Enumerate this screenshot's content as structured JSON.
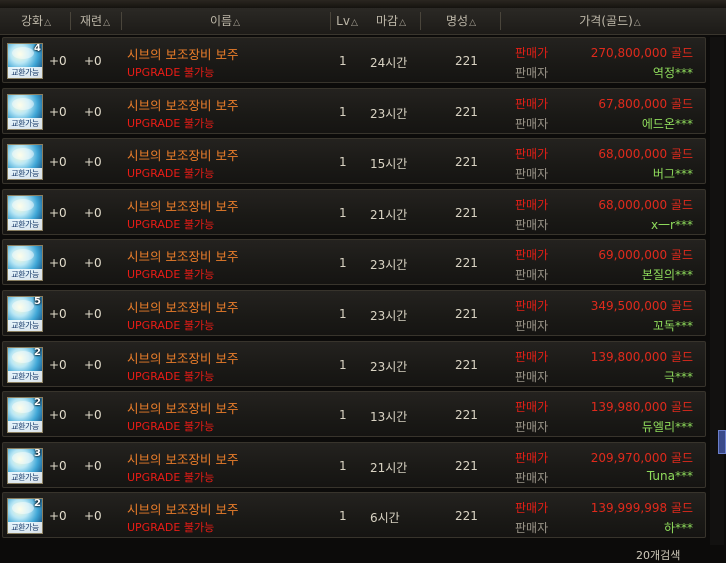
{
  "header": {
    "enhance": "강화",
    "refine": "재련",
    "name": "이름",
    "lv": "Lv",
    "deadline": "마감",
    "fame": "명성",
    "price": "가격(골드)",
    "sort_icon": "triangle-sort-icon"
  },
  "rows": [
    {
      "stack": "4",
      "icon_label": "교환가능",
      "enhance": "+0",
      "refine": "+0",
      "name": "시브의 보조장비 보주",
      "upgrade": "UPGRADE 불가능",
      "lv": "1",
      "deadline": "24시간",
      "fame": "221",
      "seller_type": "판매가",
      "seller_label": "판매자",
      "price": "270,800,000 골드",
      "seller": "역정***"
    },
    {
      "stack": "",
      "icon_label": "교환가능",
      "enhance": "+0",
      "refine": "+0",
      "name": "시브의 보조장비 보주",
      "upgrade": "UPGRADE 불가능",
      "lv": "1",
      "deadline": "23시간",
      "fame": "221",
      "seller_type": "판매가",
      "seller_label": "판매자",
      "price": "67,800,000 골드",
      "seller": "에드온***"
    },
    {
      "stack": "",
      "icon_label": "교환가능",
      "enhance": "+0",
      "refine": "+0",
      "name": "시브의 보조장비 보주",
      "upgrade": "UPGRADE 불가능",
      "lv": "1",
      "deadline": "15시간",
      "fame": "221",
      "seller_type": "판매가",
      "seller_label": "판매자",
      "price": "68,000,000 골드",
      "seller": "버그***"
    },
    {
      "stack": "",
      "icon_label": "교환가능",
      "enhance": "+0",
      "refine": "+0",
      "name": "시브의 보조장비 보주",
      "upgrade": "UPGRADE 불가능",
      "lv": "1",
      "deadline": "21시간",
      "fame": "221",
      "seller_type": "판매가",
      "seller_label": "판매자",
      "price": "68,000,000 골드",
      "seller": "x一r***"
    },
    {
      "stack": "",
      "icon_label": "교환가능",
      "enhance": "+0",
      "refine": "+0",
      "name": "시브의 보조장비 보주",
      "upgrade": "UPGRADE 불가능",
      "lv": "1",
      "deadline": "23시간",
      "fame": "221",
      "seller_type": "판매가",
      "seller_label": "판매자",
      "price": "69,000,000 골드",
      "seller": "본질의***"
    },
    {
      "stack": "5",
      "icon_label": "교환가능",
      "enhance": "+0",
      "refine": "+0",
      "name": "시브의 보조장비 보주",
      "upgrade": "UPGRADE 불가능",
      "lv": "1",
      "deadline": "23시간",
      "fame": "221",
      "seller_type": "판매가",
      "seller_label": "판매자",
      "price": "349,500,000 골드",
      "seller": "꼬독***"
    },
    {
      "stack": "2",
      "icon_label": "교환가능",
      "enhance": "+0",
      "refine": "+0",
      "name": "시브의 보조장비 보주",
      "upgrade": "UPGRADE 불가능",
      "lv": "1",
      "deadline": "23시간",
      "fame": "221",
      "seller_type": "판매가",
      "seller_label": "판매자",
      "price": "139,800,000 골드",
      "seller": "극***"
    },
    {
      "stack": "2",
      "icon_label": "교환가능",
      "enhance": "+0",
      "refine": "+0",
      "name": "시브의 보조장비 보주",
      "upgrade": "UPGRADE 불가능",
      "lv": "1",
      "deadline": "13시간",
      "fame": "221",
      "seller_type": "판매가",
      "seller_label": "판매자",
      "price": "139,980,000 골드",
      "seller": "듀엘리***"
    },
    {
      "stack": "3",
      "icon_label": "교환가능",
      "enhance": "+0",
      "refine": "+0",
      "name": "시브의 보조장비 보주",
      "upgrade": "UPGRADE 불가능",
      "lv": "1",
      "deadline": "21시간",
      "fame": "221",
      "seller_type": "판매가",
      "seller_label": "판매자",
      "price": "209,970,000 골드",
      "seller": "Tuna***"
    },
    {
      "stack": "2",
      "icon_label": "교환가능",
      "enhance": "+0",
      "refine": "+0",
      "name": "시브의 보조장비 보주",
      "upgrade": "UPGRADE 불가능",
      "lv": "1",
      "deadline": "6시간",
      "fame": "221",
      "seller_type": "판매가",
      "seller_label": "판매자",
      "price": "139,999,998 골드",
      "seller": "하***"
    }
  ],
  "footer": {
    "count": "20개검색"
  },
  "colors": {
    "name": "#ea7d2a",
    "upgrade": "#e81c16",
    "price": "#e02a1c",
    "seller": "#8fdc5c"
  }
}
